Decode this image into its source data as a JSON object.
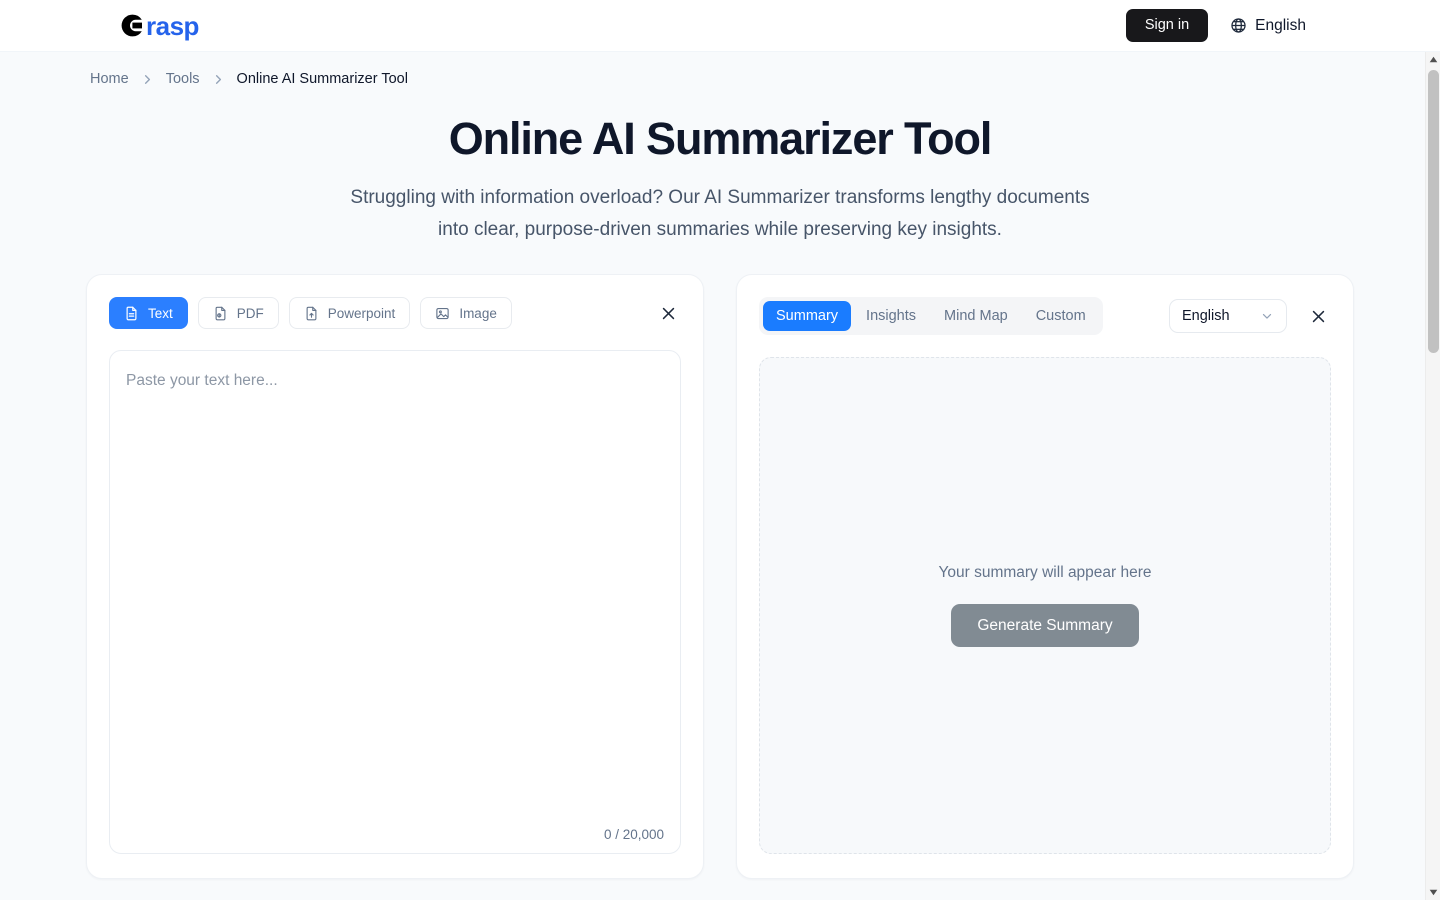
{
  "header": {
    "logo_mark": "G",
    "logo_text": "rasp",
    "signin_label": "Sign in",
    "language_label": "English",
    "globe_icon": "globe-icon"
  },
  "breadcrumb": {
    "items": [
      {
        "label": "Home",
        "current": false
      },
      {
        "label": "Tools",
        "current": false
      },
      {
        "label": "Online AI Summarizer Tool",
        "current": true
      }
    ]
  },
  "hero": {
    "title": "Online AI Summarizer Tool",
    "subtitle": "Struggling with information overload? Our AI Summarizer transforms lengthy documents into clear, purpose-driven summaries while preserving key insights."
  },
  "input_panel": {
    "tabs": [
      {
        "label": "Text",
        "icon": "document-text-icon",
        "active": true
      },
      {
        "label": "PDF",
        "icon": "file-pdf-icon",
        "active": false
      },
      {
        "label": "Powerpoint",
        "icon": "file-upload-icon",
        "active": false
      },
      {
        "label": "Image",
        "icon": "image-icon",
        "active": false
      }
    ],
    "close_icon": "close-icon",
    "textarea": {
      "placeholder": "Paste your text here...",
      "value": ""
    },
    "char_counter": "0 / 20,000"
  },
  "output_panel": {
    "tabs": [
      {
        "label": "Summary",
        "active": true
      },
      {
        "label": "Insights",
        "active": false
      },
      {
        "label": "Mind Map",
        "active": false
      },
      {
        "label": "Custom",
        "active": false
      }
    ],
    "language_select": {
      "value": "English",
      "chevron_icon": "chevron-down-icon"
    },
    "close_icon": "close-icon",
    "empty_hint": "Your summary will appear here",
    "generate_label": "Generate Summary"
  },
  "colors": {
    "accent_blue": "#2b7fff",
    "page_bg": "#f8fafc",
    "text_dark": "#0f172a",
    "text_muted": "#64748b",
    "button_dark": "#18181b",
    "generate_disabled": "#818b93"
  }
}
